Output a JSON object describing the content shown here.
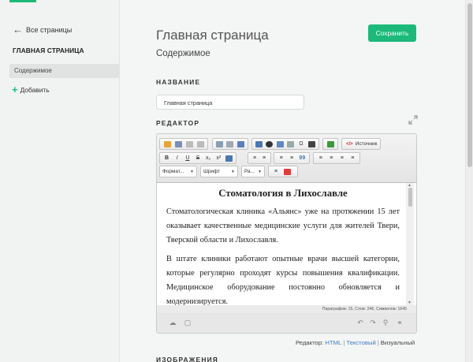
{
  "sidebar": {
    "back_label": "Все страницы",
    "title": "ГЛАВНАЯ СТРАНИЦА",
    "active_item": "Содержимое",
    "add_label": "Добавить"
  },
  "header": {
    "title": "Главная страница",
    "subtitle": "Содержимое",
    "save_label": "Сохранить"
  },
  "name_section": {
    "label": "НАЗВАНИЕ",
    "value": "Главная страница"
  },
  "editor_section": {
    "label": "РЕДАКТОР",
    "toolbar": {
      "source_label": "Источник",
      "format_label": "Формат...",
      "font_label": "Шрифт",
      "size_label": "Ра...",
      "b": "B",
      "i": "I",
      "u": "U",
      "s": "S",
      "sub": "x₂",
      "sup": "x²",
      "quote": "99"
    },
    "content": {
      "heading": "Стоматология в Лихославле",
      "paragraph1": "Стоматологическая клиника «Альянс»  уже на протяжении 15 лет оказывает качественные медицинские услуги для жителей Твери, Тверской области и Лихославля.",
      "paragraph2": "В штате клиники работают опытные врачи высшей категории, которые регулярно проходят курсы повышения квалификации. Медицинское оборудование постоянно обновляется и модернизируется."
    },
    "status": "Параграфов: 15, Слов: 246, Символов: 1645"
  },
  "mode": {
    "prefix": "Редактор:",
    "html": "HTML",
    "text": "Текстовый",
    "visual": "Визуальный"
  },
  "images_section": {
    "label": "ИЗОБРАЖЕНИЯ"
  },
  "colors": {
    "accent": "#1db97a",
    "link": "#3b7fc4"
  },
  "icons": [
    "arrow-left-icon",
    "plus-icon",
    "expand-icon",
    "source-icon",
    "cloud-icon",
    "undo-icon",
    "redo-icon",
    "search-icon",
    "glasses-icon"
  ]
}
